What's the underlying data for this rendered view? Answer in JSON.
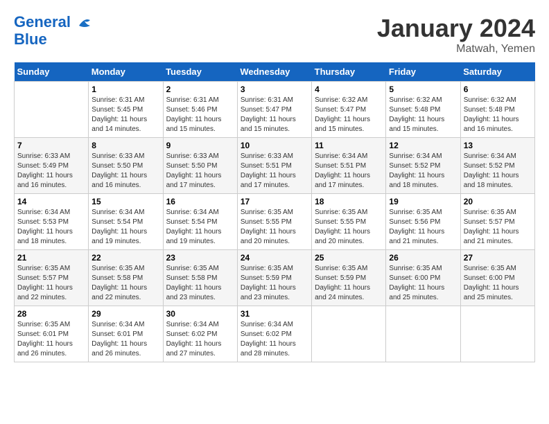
{
  "header": {
    "logo_line1": "General",
    "logo_line2": "Blue",
    "month": "January 2024",
    "location": "Matwah, Yemen"
  },
  "weekdays": [
    "Sunday",
    "Monday",
    "Tuesday",
    "Wednesday",
    "Thursday",
    "Friday",
    "Saturday"
  ],
  "weeks": [
    [
      {
        "num": "",
        "sunrise": "",
        "sunset": "",
        "daylight": ""
      },
      {
        "num": "1",
        "sunrise": "6:31 AM",
        "sunset": "5:45 PM",
        "daylight": "11 hours and 14 minutes."
      },
      {
        "num": "2",
        "sunrise": "6:31 AM",
        "sunset": "5:46 PM",
        "daylight": "11 hours and 15 minutes."
      },
      {
        "num": "3",
        "sunrise": "6:31 AM",
        "sunset": "5:47 PM",
        "daylight": "11 hours and 15 minutes."
      },
      {
        "num": "4",
        "sunrise": "6:32 AM",
        "sunset": "5:47 PM",
        "daylight": "11 hours and 15 minutes."
      },
      {
        "num": "5",
        "sunrise": "6:32 AM",
        "sunset": "5:48 PM",
        "daylight": "11 hours and 15 minutes."
      },
      {
        "num": "6",
        "sunrise": "6:32 AM",
        "sunset": "5:48 PM",
        "daylight": "11 hours and 16 minutes."
      }
    ],
    [
      {
        "num": "7",
        "sunrise": "6:33 AM",
        "sunset": "5:49 PM",
        "daylight": "11 hours and 16 minutes."
      },
      {
        "num": "8",
        "sunrise": "6:33 AM",
        "sunset": "5:50 PM",
        "daylight": "11 hours and 16 minutes."
      },
      {
        "num": "9",
        "sunrise": "6:33 AM",
        "sunset": "5:50 PM",
        "daylight": "11 hours and 17 minutes."
      },
      {
        "num": "10",
        "sunrise": "6:33 AM",
        "sunset": "5:51 PM",
        "daylight": "11 hours and 17 minutes."
      },
      {
        "num": "11",
        "sunrise": "6:34 AM",
        "sunset": "5:51 PM",
        "daylight": "11 hours and 17 minutes."
      },
      {
        "num": "12",
        "sunrise": "6:34 AM",
        "sunset": "5:52 PM",
        "daylight": "11 hours and 18 minutes."
      },
      {
        "num": "13",
        "sunrise": "6:34 AM",
        "sunset": "5:52 PM",
        "daylight": "11 hours and 18 minutes."
      }
    ],
    [
      {
        "num": "14",
        "sunrise": "6:34 AM",
        "sunset": "5:53 PM",
        "daylight": "11 hours and 18 minutes."
      },
      {
        "num": "15",
        "sunrise": "6:34 AM",
        "sunset": "5:54 PM",
        "daylight": "11 hours and 19 minutes."
      },
      {
        "num": "16",
        "sunrise": "6:34 AM",
        "sunset": "5:54 PM",
        "daylight": "11 hours and 19 minutes."
      },
      {
        "num": "17",
        "sunrise": "6:35 AM",
        "sunset": "5:55 PM",
        "daylight": "11 hours and 20 minutes."
      },
      {
        "num": "18",
        "sunrise": "6:35 AM",
        "sunset": "5:55 PM",
        "daylight": "11 hours and 20 minutes."
      },
      {
        "num": "19",
        "sunrise": "6:35 AM",
        "sunset": "5:56 PM",
        "daylight": "11 hours and 21 minutes."
      },
      {
        "num": "20",
        "sunrise": "6:35 AM",
        "sunset": "5:57 PM",
        "daylight": "11 hours and 21 minutes."
      }
    ],
    [
      {
        "num": "21",
        "sunrise": "6:35 AM",
        "sunset": "5:57 PM",
        "daylight": "11 hours and 22 minutes."
      },
      {
        "num": "22",
        "sunrise": "6:35 AM",
        "sunset": "5:58 PM",
        "daylight": "11 hours and 22 minutes."
      },
      {
        "num": "23",
        "sunrise": "6:35 AM",
        "sunset": "5:58 PM",
        "daylight": "11 hours and 23 minutes."
      },
      {
        "num": "24",
        "sunrise": "6:35 AM",
        "sunset": "5:59 PM",
        "daylight": "11 hours and 23 minutes."
      },
      {
        "num": "25",
        "sunrise": "6:35 AM",
        "sunset": "5:59 PM",
        "daylight": "11 hours and 24 minutes."
      },
      {
        "num": "26",
        "sunrise": "6:35 AM",
        "sunset": "6:00 PM",
        "daylight": "11 hours and 25 minutes."
      },
      {
        "num": "27",
        "sunrise": "6:35 AM",
        "sunset": "6:00 PM",
        "daylight": "11 hours and 25 minutes."
      }
    ],
    [
      {
        "num": "28",
        "sunrise": "6:35 AM",
        "sunset": "6:01 PM",
        "daylight": "11 hours and 26 minutes."
      },
      {
        "num": "29",
        "sunrise": "6:34 AM",
        "sunset": "6:01 PM",
        "daylight": "11 hours and 26 minutes."
      },
      {
        "num": "30",
        "sunrise": "6:34 AM",
        "sunset": "6:02 PM",
        "daylight": "11 hours and 27 minutes."
      },
      {
        "num": "31",
        "sunrise": "6:34 AM",
        "sunset": "6:02 PM",
        "daylight": "11 hours and 28 minutes."
      },
      {
        "num": "",
        "sunrise": "",
        "sunset": "",
        "daylight": ""
      },
      {
        "num": "",
        "sunrise": "",
        "sunset": "",
        "daylight": ""
      },
      {
        "num": "",
        "sunrise": "",
        "sunset": "",
        "daylight": ""
      }
    ]
  ]
}
